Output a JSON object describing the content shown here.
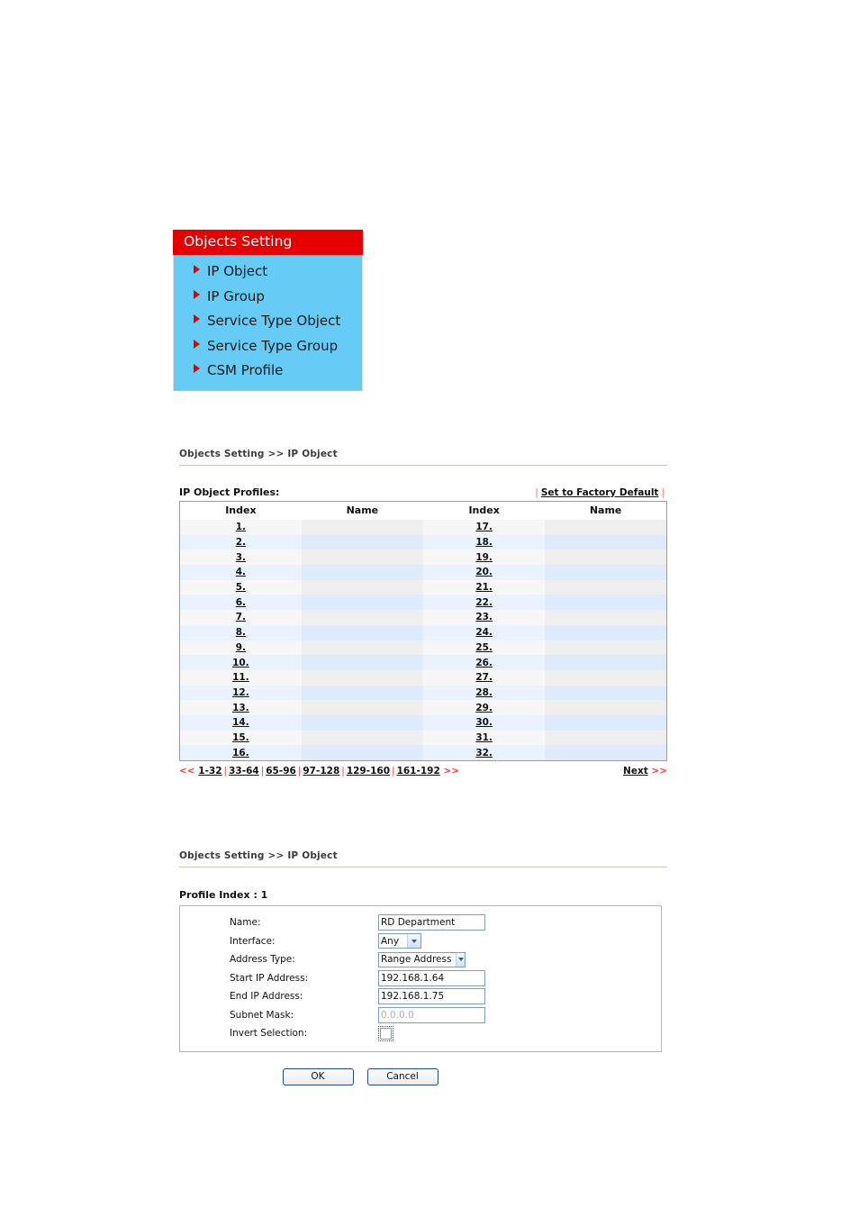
{
  "menu": {
    "title": "Objects Setting",
    "items": [
      {
        "label": "IP Object"
      },
      {
        "label": "IP Group"
      },
      {
        "label": "Service Type Object"
      },
      {
        "label": "Service Type Group"
      },
      {
        "label": "CSM Profile"
      }
    ],
    "colors": {
      "header_bg": "#E60000",
      "header_text": "#FFFFFF",
      "body_bg": "#66CCF5",
      "bullet": "#E00000"
    }
  },
  "list_page": {
    "breadcrumb": "Objects Setting >> IP Object",
    "profiles_title": "IP Object Profiles:",
    "factory_default": {
      "bar": "|",
      "label": "Set to Factory Default"
    },
    "columns": [
      "Index",
      "Name",
      "Index",
      "Name"
    ],
    "rows": [
      {
        "left_index": "1.",
        "left_name": "",
        "right_index": "17.",
        "right_name": ""
      },
      {
        "left_index": "2.",
        "left_name": "",
        "right_index": "18.",
        "right_name": ""
      },
      {
        "left_index": "3.",
        "left_name": "",
        "right_index": "19.",
        "right_name": ""
      },
      {
        "left_index": "4.",
        "left_name": "",
        "right_index": "20.",
        "right_name": ""
      },
      {
        "left_index": "5.",
        "left_name": "",
        "right_index": "21.",
        "right_name": ""
      },
      {
        "left_index": "6.",
        "left_name": "",
        "right_index": "22.",
        "right_name": ""
      },
      {
        "left_index": "7.",
        "left_name": "",
        "right_index": "23.",
        "right_name": ""
      },
      {
        "left_index": "8.",
        "left_name": "",
        "right_index": "24.",
        "right_name": ""
      },
      {
        "left_index": "9.",
        "left_name": "",
        "right_index": "25.",
        "right_name": ""
      },
      {
        "left_index": "10.",
        "left_name": "",
        "right_index": "26.",
        "right_name": ""
      },
      {
        "left_index": "11.",
        "left_name": "",
        "right_index": "27.",
        "right_name": ""
      },
      {
        "left_index": "12.",
        "left_name": "",
        "right_index": "28.",
        "right_name": ""
      },
      {
        "left_index": "13.",
        "left_name": "",
        "right_index": "29.",
        "right_name": ""
      },
      {
        "left_index": "14.",
        "left_name": "",
        "right_index": "30.",
        "right_name": ""
      },
      {
        "left_index": "15.",
        "left_name": "",
        "right_index": "31.",
        "right_name": ""
      },
      {
        "left_index": "16.",
        "left_name": "",
        "right_index": "32.",
        "right_name": ""
      }
    ],
    "pager": {
      "prev_arrows": "<<",
      "ranges": [
        "1-32",
        "33-64",
        "65-96",
        "97-128",
        "129-160",
        "161-192"
      ],
      "separator": "|",
      "next_arrows": ">>",
      "next_label": "Next",
      "next_suffix": ">>"
    }
  },
  "edit_page": {
    "breadcrumb": "Objects Setting >> IP Object",
    "profile_index": "Profile Index : 1",
    "fields": {
      "name": {
        "label": "Name:",
        "value": "RD Department"
      },
      "interface": {
        "label": "Interface:",
        "value": "Any"
      },
      "address_type": {
        "label": "Address Type:",
        "value": "Range Address"
      },
      "start_ip": {
        "label": "Start IP Address:",
        "value": "192.168.1.64"
      },
      "end_ip": {
        "label": "End IP Address:",
        "value": "192.168.1.75"
      },
      "subnet_mask": {
        "label": "Subnet Mask:",
        "value": "0.0.0.0"
      },
      "invert_selection": {
        "label": "Invert Selection:",
        "checked": false
      }
    },
    "buttons": {
      "ok": "OK",
      "cancel": "Cancel"
    }
  }
}
